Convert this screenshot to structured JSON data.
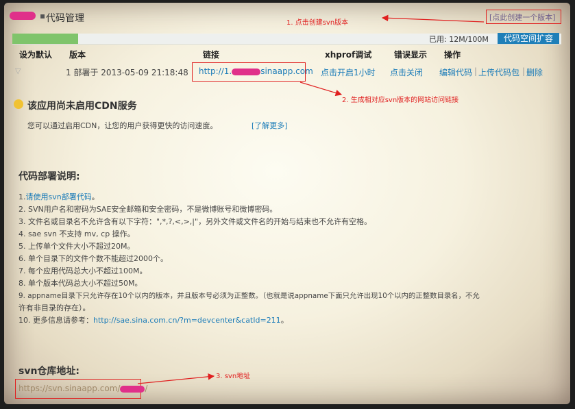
{
  "header": {
    "title": "代码管理",
    "create_link": "[点此创建一个版本]"
  },
  "quota": {
    "used_label": "已用: 12M/100M",
    "used_fraction": 0.12,
    "expand_button": "代码空间扩容"
  },
  "table": {
    "headers": [
      "设为默认",
      "版本",
      "链接",
      "xhprof调试",
      "错误显示",
      "操作"
    ],
    "row": {
      "version": "1 部署于 2013-05-09 21:18:48",
      "link_prefix": "http://1.",
      "link_suffix": "sinaapp.com",
      "xhprof": "点击开启1小时",
      "error_display": "点击关闭",
      "action_edit": "编辑代码",
      "sep1": "|",
      "action_upload": "上传代码包",
      "sep2": "|",
      "action_delete": "删除"
    }
  },
  "cdn": {
    "title": "该应用尚未启用CDN服务",
    "desc": "您可以通过启用CDN，让您的用户获得更快的访问速度。",
    "learn_more": "[了解更多]"
  },
  "deploy": {
    "title": "代码部署说明:",
    "item1_prefix": "1.",
    "item1_link": "请使用svn部署代码",
    "item1_suffix": "。",
    "items": [
      "2. SVN用户名和密码为SAE安全邮箱和安全密码，不是微博账号和微博密码。",
      "3. 文件名或目录名不允许含有以下字符：\",*,?,<,>,|\"，另外文件或文件名的开始与结束也不允许有空格。",
      "4. sae svn 不支持 mv, cp 操作。",
      "5. 上传单个文件大小不超过20M。",
      "6. 单个目录下的文件个数不能超过2000个。",
      "7. 每个应用代码总大小不超过100M。",
      "8. 单个版本代码总大小不超过50M。",
      "9. appname目录下只允许存在10个以内的版本，并且版本号必须为正整数。（也就是说appname下面只允许出现10个以内的正整数目录名，不允",
      "许有非目录的存在）。"
    ],
    "item10_prefix": "10. 更多信息请参考：",
    "item10_link": "http://sae.sina.com.cn/?m=devcenter&catId=211",
    "item10_suffix": "。"
  },
  "svn": {
    "title": "svn仓库地址:",
    "url_prefix": "https://svn.sinaapp.com/",
    "url_suffix": "/"
  },
  "annotations": {
    "a1": "1. 点击创建svn版本",
    "a2": "2. 生成相对应svn版本的网站访问链接",
    "a3": "3. svn地址"
  },
  "colors": {
    "accent": "#1f7fb8",
    "annotation": "#e02020",
    "quota_fill": "#7fc46b",
    "redaction": "#e0308a"
  }
}
